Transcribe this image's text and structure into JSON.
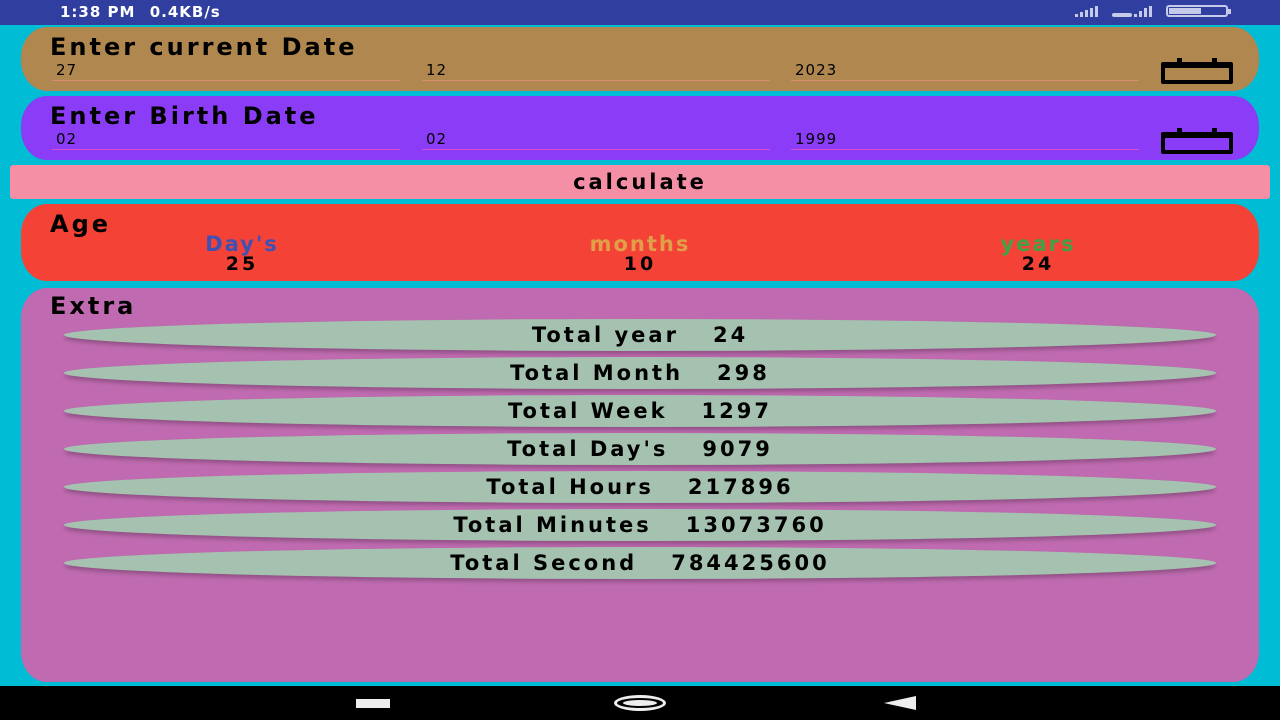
{
  "status_bar": {
    "time": "1:38 PM",
    "speed": "0.4KB/s",
    "battery": "58"
  },
  "current_date": {
    "title": "Enter current Date",
    "day": "27",
    "month": "12",
    "year": "2023",
    "icon": "calendar-icon",
    "color": "#b0884f"
  },
  "birth_date": {
    "title": "Enter Birth Date",
    "day": "02",
    "month": "02",
    "year": "1999",
    "icon": "calendar-icon",
    "color": "#8a3cf7"
  },
  "calculate_label": "calculate",
  "age": {
    "title": "Age",
    "days_label": "Day's",
    "months_label": "months",
    "years_label": "years",
    "days": "25",
    "months": "10",
    "years": "24",
    "colors": {
      "days": "#3f51b5",
      "months": "#e0a04a",
      "years": "#43a047",
      "card": "#f44336"
    }
  },
  "extra": {
    "title": "Extra",
    "rows": [
      {
        "label": "Total year",
        "value": "24"
      },
      {
        "label": "Total Month",
        "value": "298"
      },
      {
        "label": "Total Week",
        "value": "1297"
      },
      {
        "label": "Total Day's",
        "value": "9079"
      },
      {
        "label": "Total Hours",
        "value": "217896"
      },
      {
        "label": "Total Minutes",
        "value": "13073760"
      },
      {
        "label": "Total Second",
        "value": "784425600"
      }
    ]
  },
  "nav": {
    "recent": "recent-apps-icon",
    "home": "home-icon",
    "back": "back-icon"
  }
}
